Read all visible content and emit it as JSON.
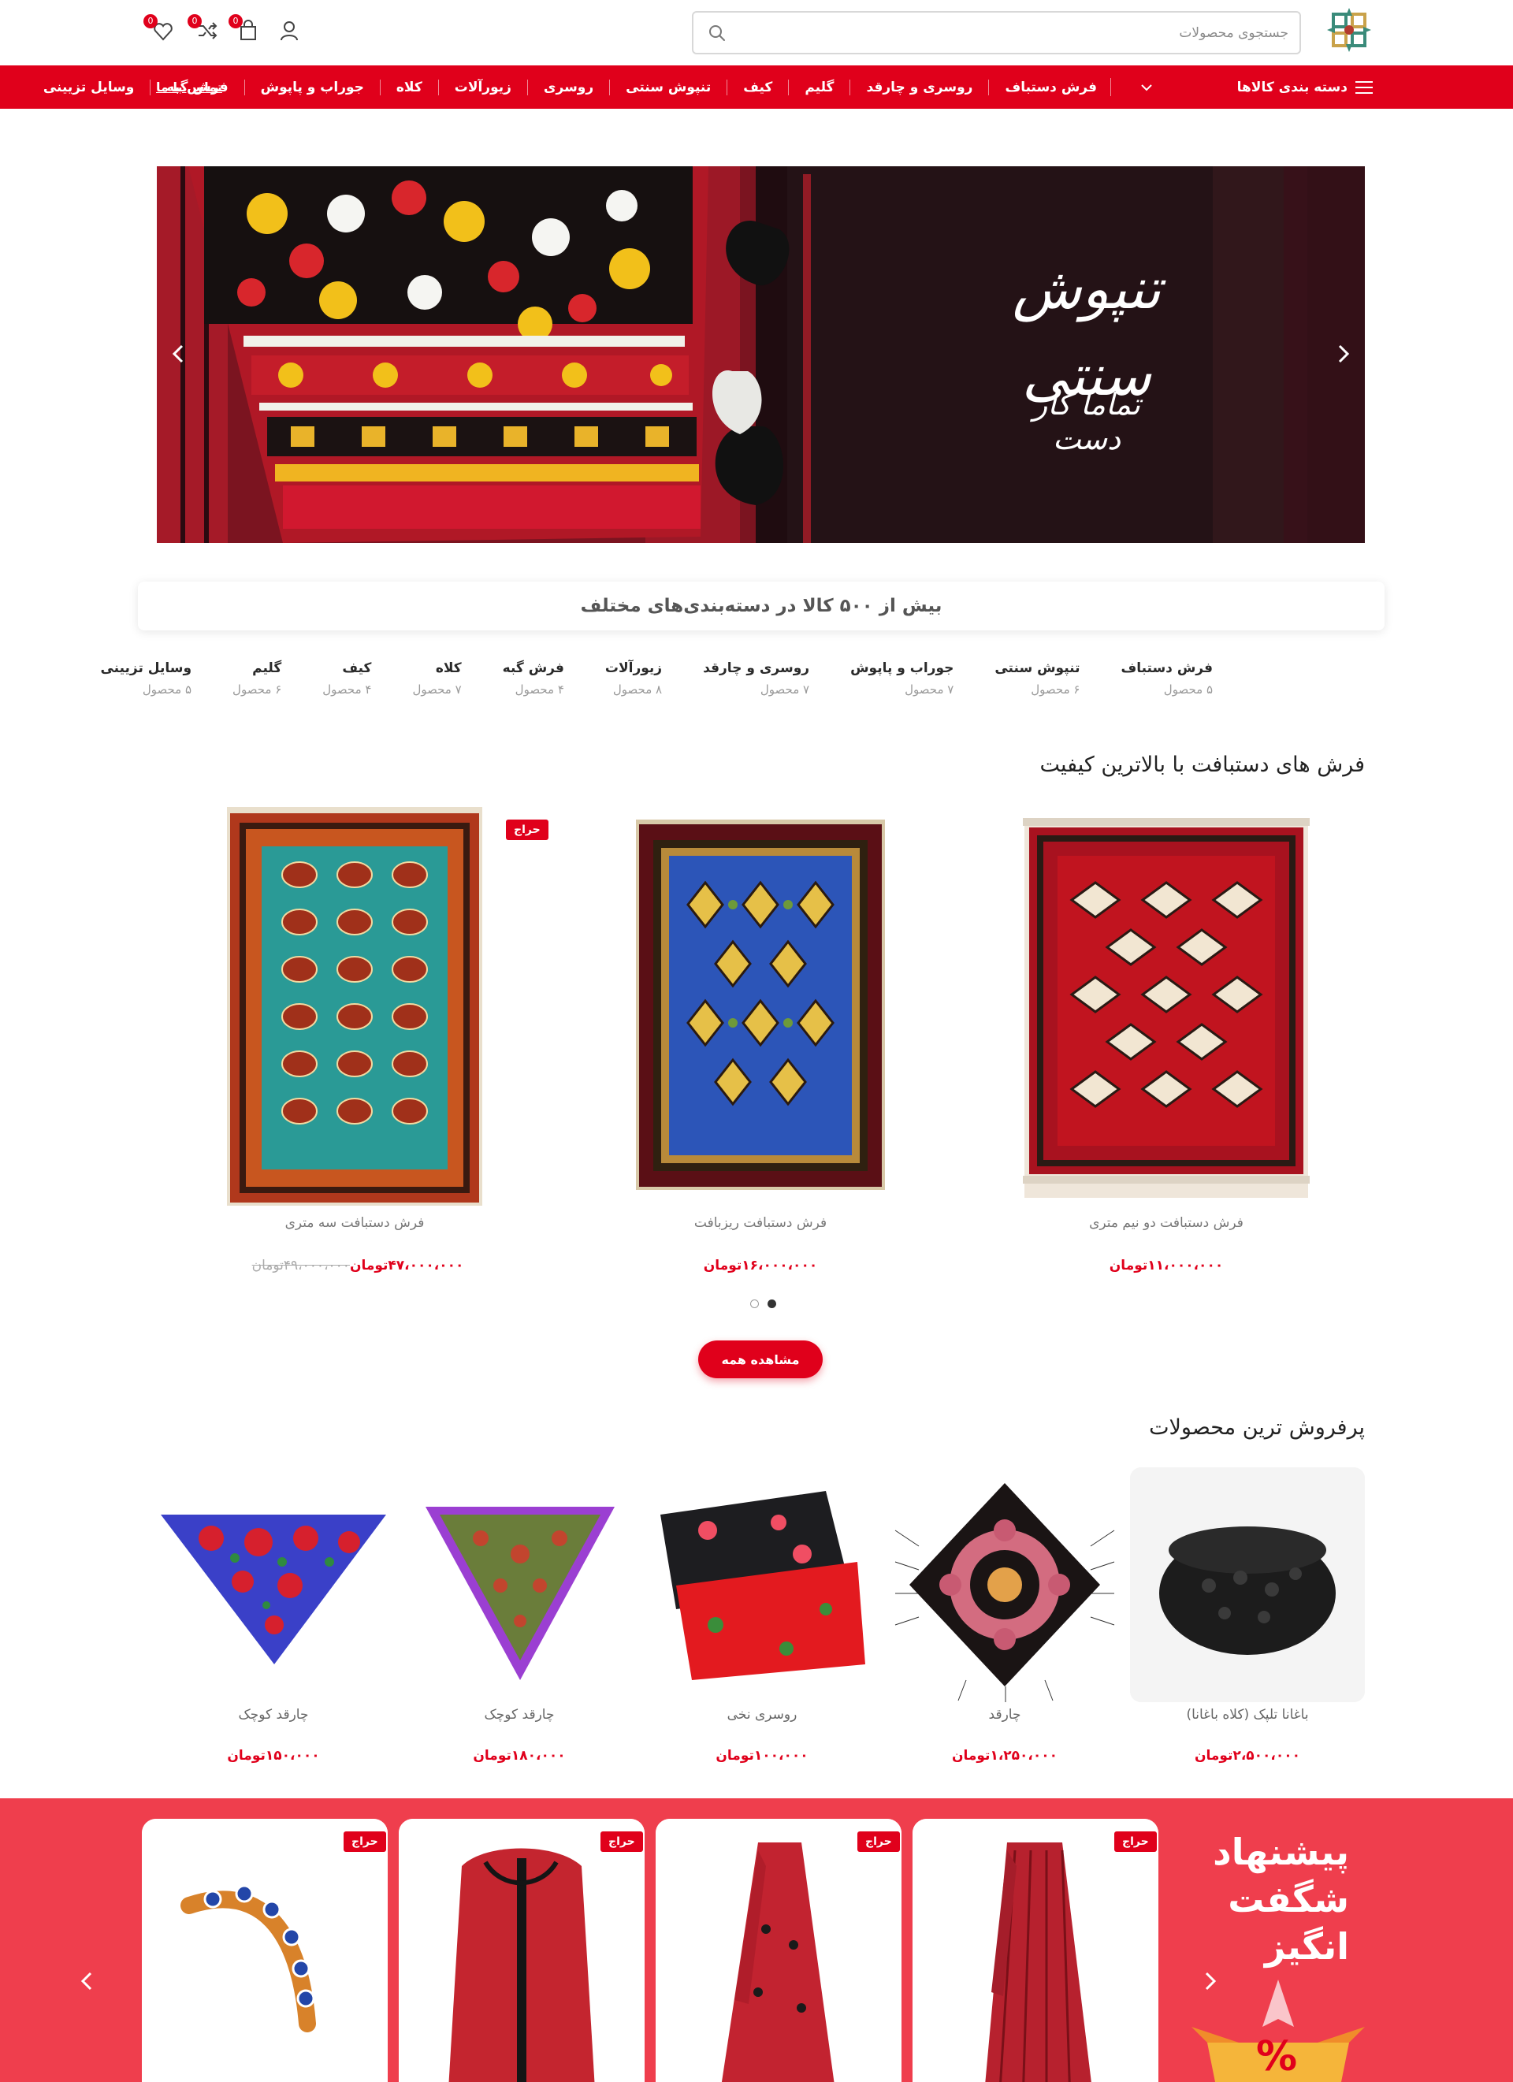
{
  "header": {
    "search_placeholder": "جستجوی محصولات",
    "badges": {
      "cart": "0",
      "compare": "0",
      "wishlist": "0"
    }
  },
  "nav": {
    "categories_label": "دسته بندی کالاها",
    "items": [
      "فرش دستباف",
      "روسری و چارقد",
      "گلیم",
      "کیف",
      "تنپوش سنتی",
      "روسری",
      "زیورآلات",
      "کلاه",
      "جوراب و پاپوش",
      "فرش گبه",
      "وسایل تزیینی"
    ],
    "contact": "تماس با ما"
  },
  "hero": {
    "title": "تنپوش سنتی",
    "subtitle": "تماما کار دست"
  },
  "categories": {
    "headline": "بیش از ۵۰۰ کالا در دسته‌بندی‌های مختلف",
    "items": [
      {
        "name": "فرش دستباف",
        "count": "۵ محصول"
      },
      {
        "name": "تنپوش سنتی",
        "count": "۶ محصول"
      },
      {
        "name": "جوراب و پاپوش",
        "count": "۷ محصول"
      },
      {
        "name": "روسری و چارقد",
        "count": "۷ محصول"
      },
      {
        "name": "زیورآلات",
        "count": "۸ محصول"
      },
      {
        "name": "فرش گبه",
        "count": "۴ محصول"
      },
      {
        "name": "کلاه",
        "count": "۷ محصول"
      },
      {
        "name": "کیف",
        "count": "۴ محصول"
      },
      {
        "name": "گلیم",
        "count": "۶ محصول"
      },
      {
        "name": "وسایل تزیینی",
        "count": "۵ محصول"
      }
    ]
  },
  "carpets": {
    "title": "فرش های دستبافت با بالاترین کیفیت",
    "sale_label": "حراج",
    "items": [
      {
        "name": "فرش دستبافت دو نیم متری",
        "price": "۱۱،۰۰۰،۰۰۰تومان",
        "old_price": ""
      },
      {
        "name": "فرش دستبافت ریزبافت",
        "price": "۱۶،۰۰۰،۰۰۰تومان",
        "old_price": ""
      },
      {
        "name": "فرش دستبافت سه متری",
        "price": "۴۷،۰۰۰،۰۰۰تومان",
        "old_price": "۴۹،۰۰۰،۰۰۰تومان"
      }
    ],
    "view_all": "مشاهده همه"
  },
  "bestsellers": {
    "title": "پرفروش ترین محصولات",
    "items": [
      {
        "name": "باغانا تلپک (کلاه باغانا)",
        "price": "۲،۵۰۰،۰۰۰تومان"
      },
      {
        "name": "چارقد",
        "price": "۱،۲۵۰،۰۰۰تومان"
      },
      {
        "name": "روسری نخی",
        "price": "۱۰۰،۰۰۰تومان"
      },
      {
        "name": "چارقد کوچک",
        "price": "۱۸۰،۰۰۰تومان"
      },
      {
        "name": "چارقد کوچک",
        "price": "۱۵۰،۰۰۰تومان"
      }
    ]
  },
  "offers": {
    "title_lines": [
      "پیشنهاد",
      "شگفت",
      "انگیز"
    ],
    "sale_label": "حراج",
    "percent": "%"
  },
  "colors": {
    "brand_red": "#e0001b",
    "offer_bg": "#ef3e4d"
  }
}
